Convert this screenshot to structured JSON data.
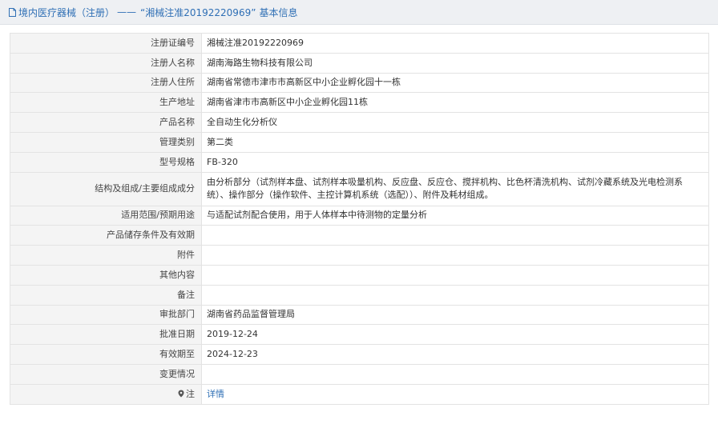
{
  "header": {
    "icon": "document-icon",
    "category": "境内医疗器械（注册）",
    "separator": "——",
    "reg_title": "“湘械注准20192220969”",
    "suffix": "基本信息"
  },
  "rows": [
    {
      "label": "注册证编号",
      "value": "湘械注准20192220969"
    },
    {
      "label": "注册人名称",
      "value": "湖南海路生物科技有限公司"
    },
    {
      "label": "注册人住所",
      "value": "湖南省常德市津市市高新区中小企业孵化园十一栋"
    },
    {
      "label": "生产地址",
      "value": "湖南省津市市高新区中小企业孵化园11栋"
    },
    {
      "label": "产品名称",
      "value": "全自动生化分析仪"
    },
    {
      "label": "管理类别",
      "value": "第二类"
    },
    {
      "label": "型号规格",
      "value": "FB-320"
    },
    {
      "label": "结构及组成/主要组成成分",
      "value": "由分析部分（试剂样本盘、试剂样本吸量机构、反应盘、反应仓、搅拌机构、比色杯清洗机构、试剂冷藏系统及光电检测系统）、操作部分（操作软件、主控计算机系统（选配））、附件及耗材组成。"
    },
    {
      "label": "适用范围/预期用途",
      "value": "与适配试剂配合使用，用于人体样本中待测物的定量分析"
    },
    {
      "label": "产品储存条件及有效期",
      "value": ""
    },
    {
      "label": "附件",
      "value": ""
    },
    {
      "label": "其他内容",
      "value": ""
    },
    {
      "label": "备注",
      "value": ""
    },
    {
      "label": "审批部门",
      "value": "湖南省药品监督管理局"
    },
    {
      "label": "批准日期",
      "value": "2019-12-24"
    },
    {
      "label": "有效期至",
      "value": "2024-12-23"
    },
    {
      "label": "变更情况",
      "value": ""
    }
  ],
  "note_row": {
    "icon": "location-pin-icon",
    "label": "注",
    "link": "详情"
  }
}
